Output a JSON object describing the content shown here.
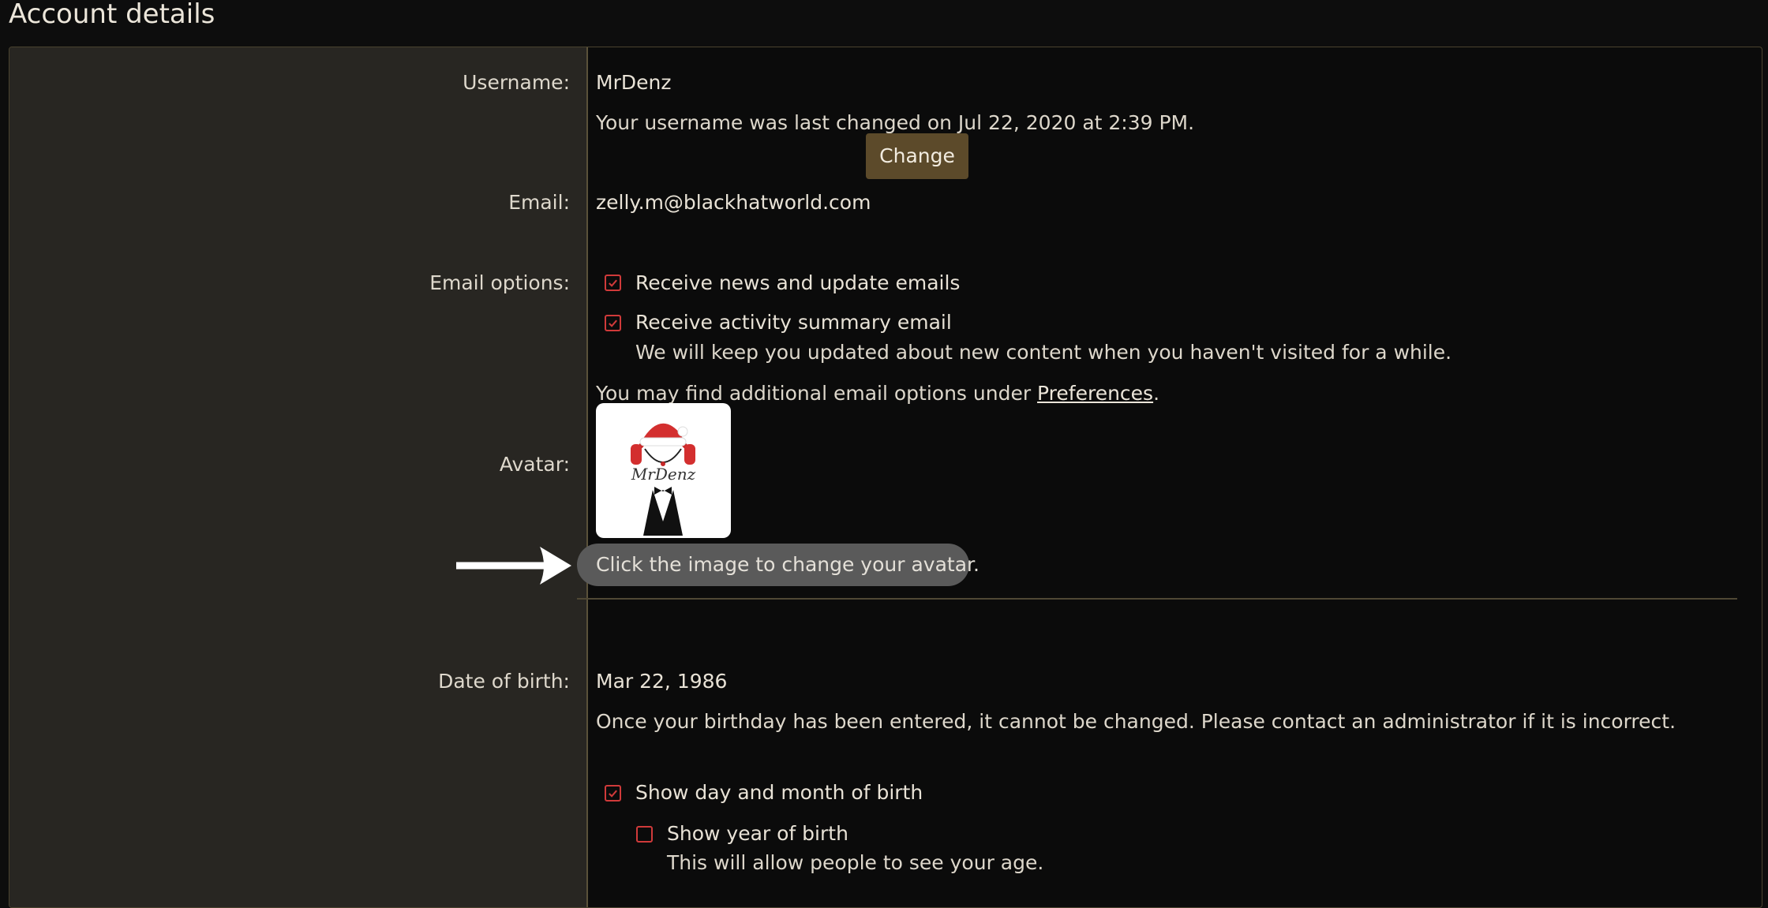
{
  "page": {
    "title": "Account details"
  },
  "username": {
    "label": "Username:",
    "value": "MrDenz",
    "note": "Your username was last changed on Jul 22, 2020 at 2:39 PM."
  },
  "email": {
    "label": "Email:",
    "value": "zelly.m@blackhatworld.com",
    "change_button": "Change"
  },
  "email_options": {
    "label": "Email options:",
    "options": [
      {
        "label": "Receive news and update emails",
        "checked": true
      },
      {
        "label": "Receive activity summary email",
        "checked": true,
        "hint": "We will keep you updated about new content when you haven't visited for a while."
      }
    ],
    "footer_prefix": "You may find additional email options under ",
    "footer_link": "Preferences",
    "footer_suffix": "."
  },
  "avatar": {
    "label": "Avatar:",
    "image_text": "MrDenz",
    "tip": "Click the image to change your avatar."
  },
  "dob": {
    "label": "Date of birth:",
    "value": "Mar 22, 1986",
    "note": "Once your birthday has been entered, it cannot be changed. Please contact an administrator if it is incorrect.",
    "show_day_month": {
      "label": "Show day and month of birth",
      "checked": true
    },
    "show_year": {
      "label": "Show year of birth",
      "checked": false,
      "hint": "This will allow people to see your age."
    }
  },
  "colors": {
    "background": "#0d0d0d",
    "label_column": "#282622",
    "button": "#5c4a2a",
    "checkbox": "#d03a3a"
  }
}
